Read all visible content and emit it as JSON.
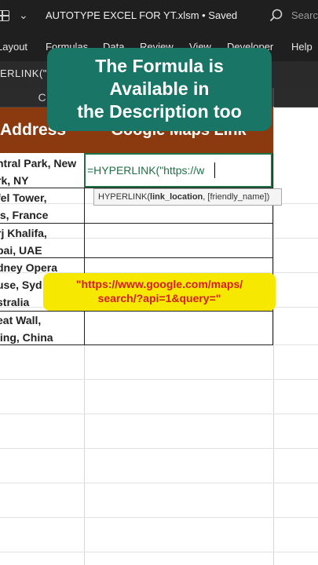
{
  "titlebar": {
    "title": "AUTOTYPE EXCEL FOR YT.xlsm • Saved",
    "chevron": "⌄",
    "search_placeholder": "Search",
    "icons": [
      "grid-icon",
      "chevron-down-icon",
      "search-icon"
    ]
  },
  "ribbon": {
    "tabs": [
      "Layout",
      "Formulas",
      "Data",
      "Review",
      "View",
      "Developer",
      "Help"
    ]
  },
  "formula_bar": {
    "text": "ERLINK(\""
  },
  "column_headers": {
    "c": "C",
    "d": ""
  },
  "table": {
    "header_c": "Address",
    "header_d": "Google Maps Link",
    "header_color": "#8b3a10",
    "rows": [
      {
        "line1": "ntral Park, New",
        "line2": "rk, NY"
      },
      {
        "line1": "fel Tower,",
        "line2": "is, France"
      },
      {
        "line1": "rj Khalifa,",
        "line2": "bai, UAE"
      },
      {
        "line1": "dney Opera",
        "line2": "use, Syd"
      },
      {
        "line1": "stralia",
        "line2": ""
      },
      {
        "line1": "eat Wall,",
        "line2": "jing, China"
      }
    ]
  },
  "active_cell": {
    "formula": "=HYPERLINK(\"https://w",
    "tooltip_fn": "HYPERLINK(",
    "tooltip_arg1": "link_location",
    "tooltip_rest": ", [friendly_name])"
  },
  "overlay": {
    "title_line1": "The Formula is",
    "title_line2": "Available in",
    "title_line3": "the Description too",
    "title_bg": "#197565",
    "url_line1": "\"https://www.google.com/maps/",
    "url_line2": "search/?api=1&query=\"",
    "url_bg": "#f7e800",
    "url_color": "#d81b1b"
  }
}
